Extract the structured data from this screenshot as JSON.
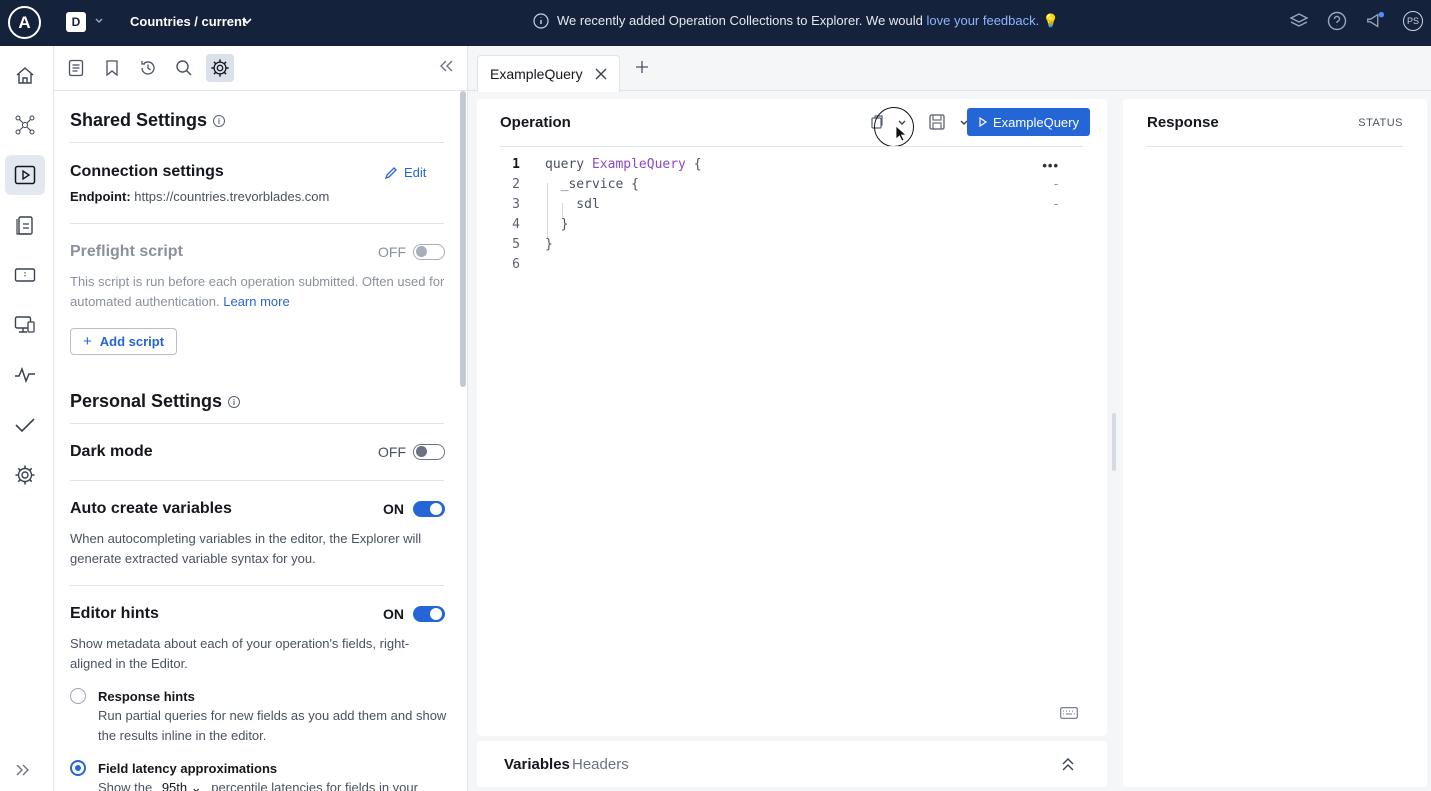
{
  "topbar": {
    "logo_letter": "A",
    "graph_badge": "D",
    "graph_name": "Countries / current",
    "banner_text": "We recently added Operation Collections to Explorer. We would ",
    "banner_link": "love your feedback.",
    "banner_emoji": "💡",
    "avatar_initials": "PS"
  },
  "settings": {
    "shared_title": "Shared Settings",
    "connection_title": "Connection settings",
    "edit_label": "Edit",
    "endpoint_label": "Endpoint:",
    "endpoint_value": "https://countries.trevorblades.com",
    "preflight_title": "Preflight script",
    "preflight_state": "OFF",
    "preflight_desc": "This script is run before each operation submitted. Often used for automated authentication.",
    "preflight_learn_more": "Learn more",
    "add_script_label": "Add script",
    "personal_title": "Personal Settings",
    "dark_mode_title": "Dark mode",
    "dark_mode_state": "OFF",
    "auto_vars_title": "Auto create variables",
    "auto_vars_state": "ON",
    "auto_vars_desc": "When autocompleting variables in the editor, the Explorer will generate extracted variable syntax for you.",
    "editor_hints_title": "Editor hints",
    "editor_hints_state": "ON",
    "editor_hints_desc": "Show metadata about each of your operation's fields, right-aligned in the Editor.",
    "response_hints_title": "Response hints",
    "response_hints_desc": "Run partial queries for new fields as you add them and show the results inline in the editor.",
    "latency_title": "Field latency approximations",
    "latency_desc_prefix": "Show the",
    "latency_percentile": "95th",
    "latency_desc_suffix": "percentile latencies for fields in your"
  },
  "tabs": [
    {
      "label": "ExampleQuery"
    }
  ],
  "operation": {
    "title": "Operation",
    "run_label": "ExampleQuery",
    "lines": [
      {
        "n": "1",
        "kw": "query ",
        "name": "ExampleQuery",
        "rest": " {",
        "hint": ""
      },
      {
        "n": "2",
        "kw": "  _service {",
        "name": "",
        "rest": "",
        "hint": "-"
      },
      {
        "n": "3",
        "kw": "    sdl",
        "name": "",
        "rest": "",
        "hint": "-"
      },
      {
        "n": "4",
        "kw": "  }",
        "name": "",
        "rest": "",
        "hint": ""
      },
      {
        "n": "5",
        "kw": "}",
        "name": "",
        "rest": "",
        "hint": ""
      },
      {
        "n": "6",
        "kw": "",
        "name": "",
        "rest": "",
        "hint": ""
      }
    ],
    "more_label": "•••"
  },
  "variables": {
    "tab_variables": "Variables",
    "tab_headers": "Headers"
  },
  "response": {
    "title": "Response",
    "status_label": "STATUS"
  },
  "colors": {
    "topbar_bg": "#15223b",
    "accent": "#2566d6",
    "query_name": "#8a4bc2"
  }
}
